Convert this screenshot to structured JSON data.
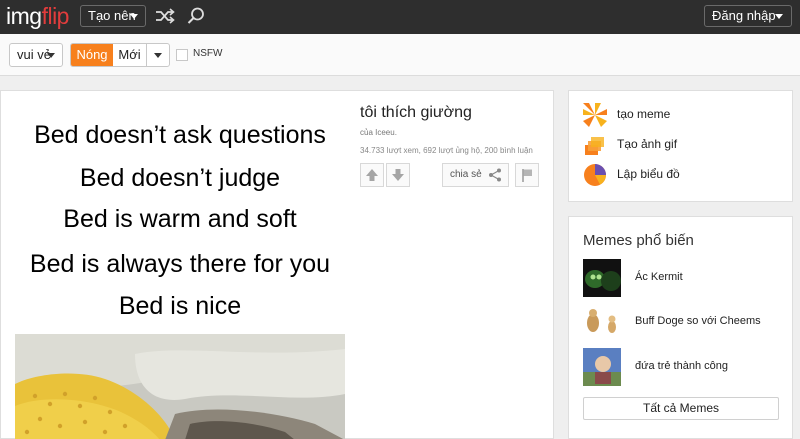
{
  "header": {
    "logo_part1": "img",
    "logo_part2": "flip",
    "create_label": "Tạo nên",
    "login_label": "Đăng nhập"
  },
  "filters": {
    "category": "vui vẻ",
    "hot_label": "Nóng",
    "new_label": "Mới",
    "nsfw_label": "NSFW"
  },
  "post": {
    "meme_lines": [
      "Bed doesn’t ask questions",
      "Bed doesn’t judge",
      "Bed is warm and soft",
      "Bed is always there for you",
      "Bed is nice"
    ],
    "title": "tôi thích giường",
    "author": "của Iceeu.",
    "stats": "34.733 lượt xem, 692 lượt ủng hộ, 200 bình luận",
    "share_label": "chia sẻ"
  },
  "tools": [
    {
      "label": "tạo meme",
      "icon": "meme-generator-icon"
    },
    {
      "label": "Tạo ảnh gif",
      "icon": "gif-maker-icon"
    },
    {
      "label": "Lập biểu đồ",
      "icon": "chart-maker-icon"
    }
  ],
  "popular": {
    "title": "Memes phổ biến",
    "items": [
      {
        "name": "Ác Kermit"
      },
      {
        "name": "Buff Doge so với Cheems"
      },
      {
        "name": "đứa trẻ thành công"
      }
    ],
    "all_label": "Tất cả Memes"
  },
  "colors": {
    "topbar": "#2e2e2e",
    "accent_orange": "#f7801d",
    "logo_red": "#e13c3c"
  }
}
